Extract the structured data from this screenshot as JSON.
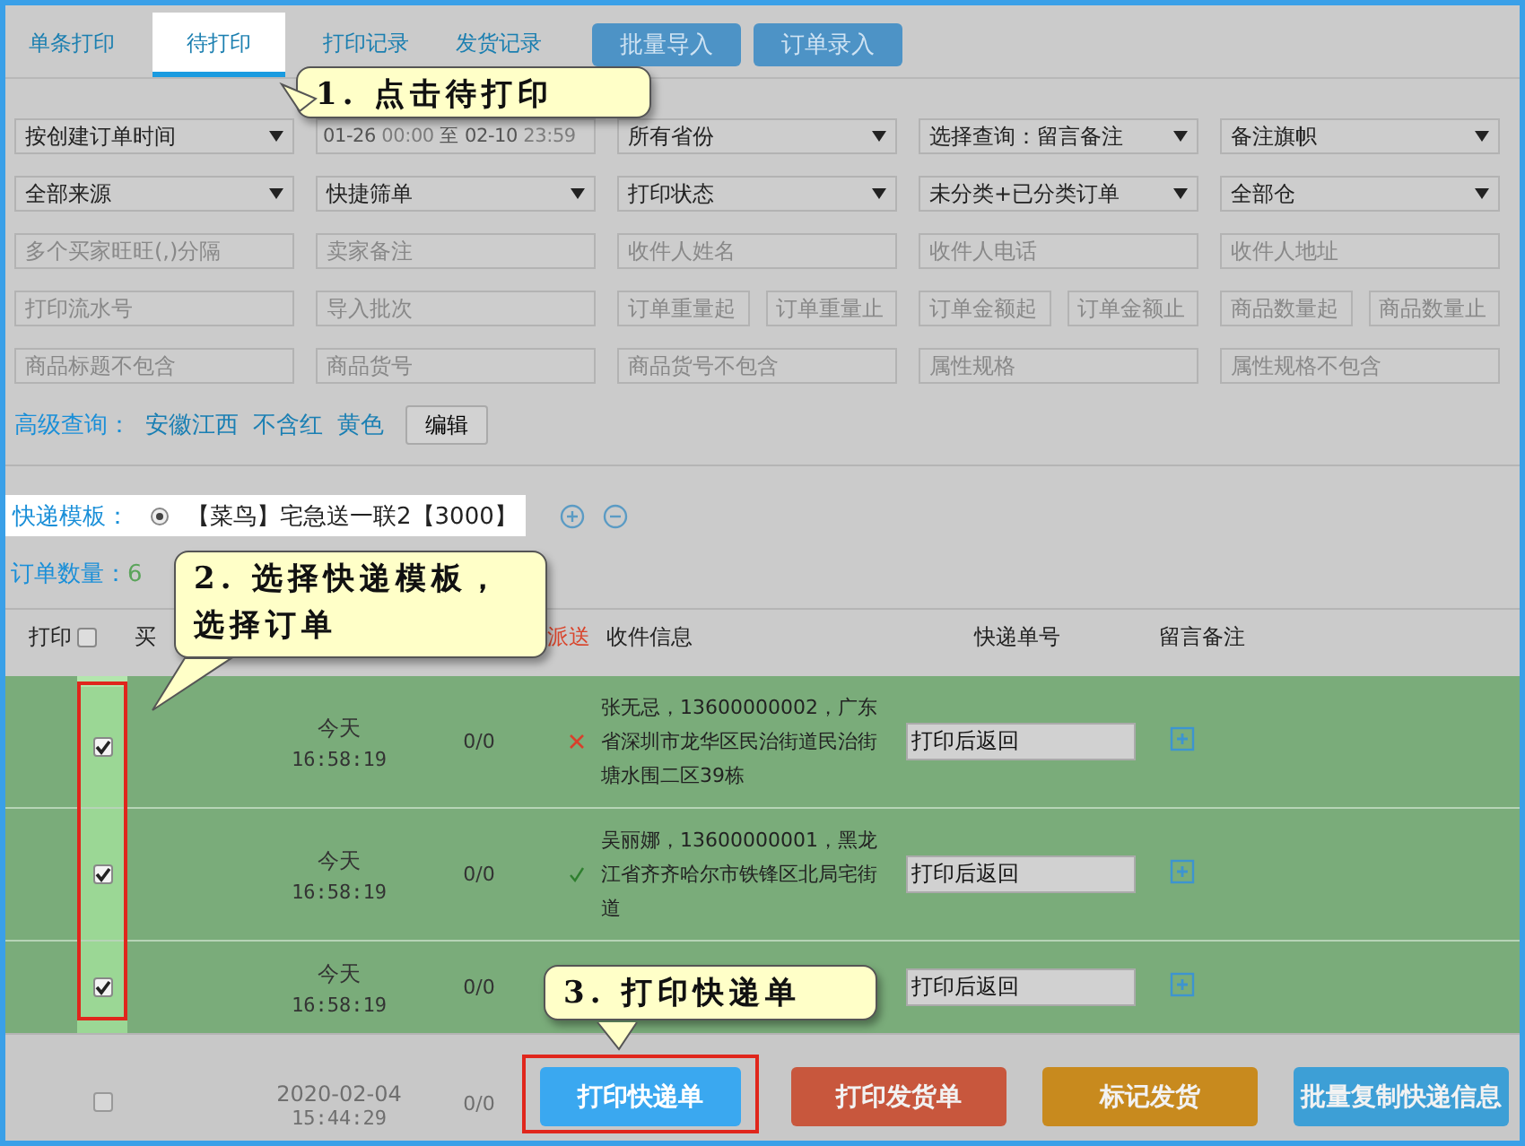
{
  "tabs": [
    {
      "label": "单条打印",
      "selected": false
    },
    {
      "label": "待打印",
      "selected": true
    },
    {
      "label": "打印记录",
      "selected": false
    },
    {
      "label": "发货记录",
      "selected": false
    }
  ],
  "top_buttons": [
    "批量导入",
    "订单录入"
  ],
  "filters": [
    [
      {
        "fields": [
          {
            "kind": "select",
            "value": "按创建订单时间"
          }
        ]
      },
      {
        "fields": [
          {
            "kind": "daterange",
            "from_date": "01-26",
            "from_time": "00:00",
            "separator": "至",
            "to_date": "02-10",
            "to_time": "23:59"
          }
        ]
      },
      {
        "fields": [
          {
            "kind": "select",
            "value": "所有省份"
          }
        ]
      },
      {
        "fields": [
          {
            "kind": "select",
            "value": "选择查询：留言备注"
          }
        ]
      },
      {
        "fields": [
          {
            "kind": "select",
            "value": "备注旗帜"
          }
        ]
      }
    ],
    [
      {
        "fields": [
          {
            "kind": "select",
            "value": "全部来源"
          }
        ]
      },
      {
        "fields": [
          {
            "kind": "select",
            "value": "快捷筛单"
          }
        ]
      },
      {
        "fields": [
          {
            "kind": "select",
            "value": "打印状态"
          }
        ]
      },
      {
        "fields": [
          {
            "kind": "select",
            "value": "未分类+已分类订单"
          }
        ]
      },
      {
        "fields": [
          {
            "kind": "select",
            "value": "全部仓"
          }
        ]
      }
    ],
    [
      {
        "fields": [
          {
            "kind": "input",
            "placeholder": "多个买家旺旺(,)分隔"
          }
        ]
      },
      {
        "fields": [
          {
            "kind": "input",
            "placeholder": "卖家备注"
          }
        ]
      },
      {
        "fields": [
          {
            "kind": "input",
            "placeholder": "收件人姓名"
          }
        ]
      },
      {
        "fields": [
          {
            "kind": "input",
            "placeholder": "收件人电话"
          }
        ]
      },
      {
        "fields": [
          {
            "kind": "input",
            "placeholder": "收件人地址"
          }
        ]
      }
    ],
    [
      {
        "fields": [
          {
            "kind": "input",
            "placeholder": "打印流水号"
          }
        ]
      },
      {
        "fields": [
          {
            "kind": "input",
            "placeholder": "导入批次"
          }
        ]
      },
      {
        "fields": [
          {
            "kind": "input",
            "placeholder": "订单重量起"
          },
          {
            "kind": "input",
            "placeholder": "订单重量止"
          }
        ]
      },
      {
        "fields": [
          {
            "kind": "input",
            "placeholder": "订单金额起"
          },
          {
            "kind": "input",
            "placeholder": "订单金额止"
          }
        ]
      },
      {
        "fields": [
          {
            "kind": "input",
            "placeholder": "商品数量起"
          },
          {
            "kind": "input",
            "placeholder": "商品数量止"
          }
        ]
      }
    ],
    [
      {
        "fields": [
          {
            "kind": "input",
            "placeholder": "商品标题不包含"
          }
        ]
      },
      {
        "fields": [
          {
            "kind": "input",
            "placeholder": "商品货号"
          }
        ]
      },
      {
        "fields": [
          {
            "kind": "input",
            "placeholder": "商品货号不包含"
          }
        ]
      },
      {
        "fields": [
          {
            "kind": "input",
            "placeholder": "属性规格"
          }
        ]
      },
      {
        "fields": [
          {
            "kind": "input",
            "placeholder": "属性规格不包含"
          }
        ]
      }
    ]
  ],
  "advanced_query": {
    "label": "高级查询：",
    "tags": [
      "安徽江西",
      "不含红",
      "黄色"
    ],
    "edit_button": "编辑"
  },
  "template": {
    "label": "快递模板：",
    "option": {
      "label": "【菜鸟】宅急送一联2【3000】",
      "selected": true
    }
  },
  "order_count": {
    "label": "订单数量：",
    "value": "6"
  },
  "table": {
    "columns": [
      "打印",
      "买",
      "派送",
      "收件信息",
      "快递单号",
      "留言备注"
    ],
    "select_all": {
      "checked": false
    },
    "checkbox_column_highlighted": true,
    "rows": [
      {
        "checked": true,
        "day": "今天",
        "time": "16:58:19",
        "count": "0/0",
        "dispatched": false,
        "address": "张无忌，13600000002，广东省深圳市龙华区民治街道民治街塘水围二区39栋",
        "tracking": "打印后返回"
      },
      {
        "checked": true,
        "day": "今天",
        "time": "16:58:19",
        "count": "0/0",
        "dispatched": true,
        "address": "吴丽娜，13600000001，黑龙江省齐齐哈尔市铁锋区北局宅街道",
        "tracking": "打印后返回"
      },
      {
        "checked": true,
        "day": "今天",
        "time": "16:58:19",
        "count": "0/0",
        "tracking": "打印后返回"
      }
    ],
    "faded_row": {
      "checked": false,
      "day": "2020-02-04",
      "time": "15:44:29",
      "count": "0/0"
    }
  },
  "actions": [
    {
      "label": "打印快递单",
      "color": "#3aa8f0",
      "highlighted": true
    },
    {
      "label": "打印发货单",
      "color": "#c8573d",
      "highlighted": false
    },
    {
      "label": "标记发货",
      "color": "#c88a1e",
      "highlighted": false
    },
    {
      "label": "批量复制快递信息",
      "color": "#3d9fd6",
      "highlighted": false
    }
  ],
  "callouts": [
    "1. 点击待打印",
    "2. 选择快递模板，选择订单",
    "3. 打印快递单"
  ]
}
